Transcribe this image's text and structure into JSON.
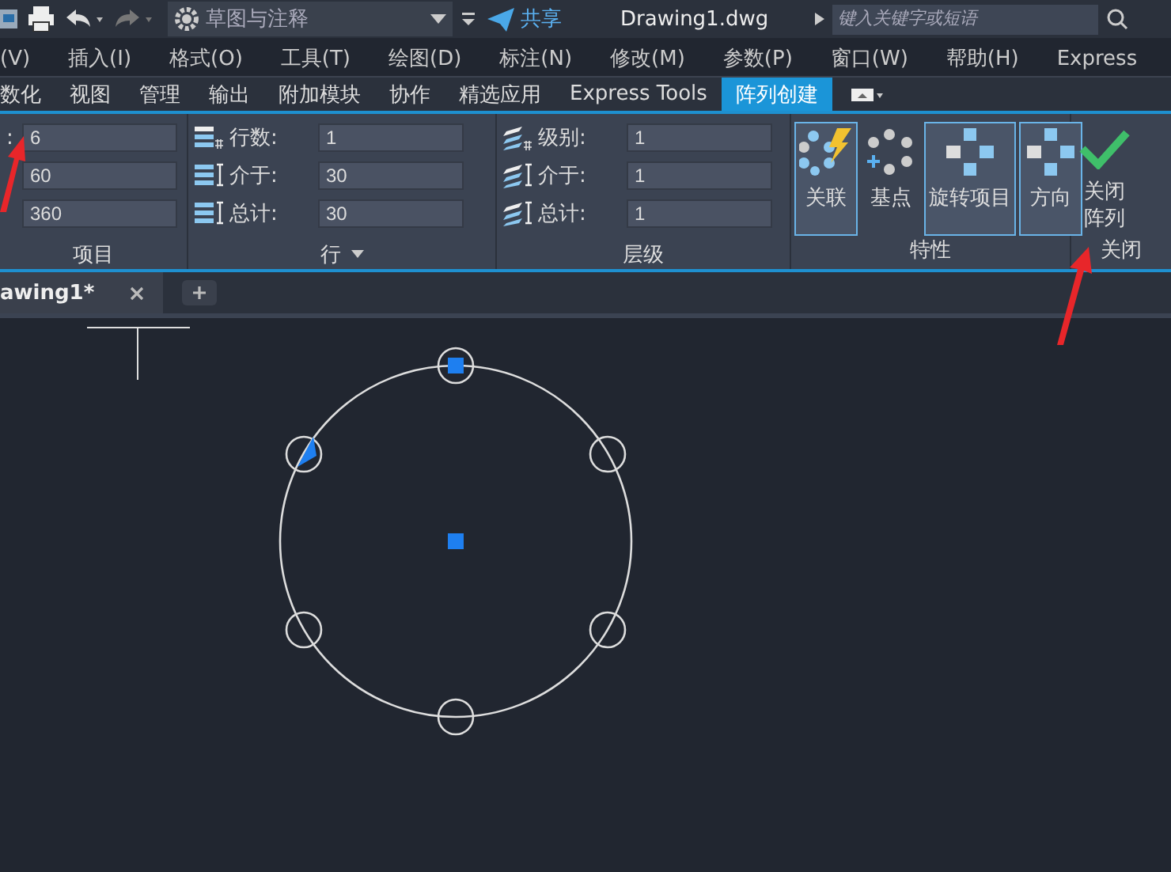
{
  "title_bar": {
    "workspace": "草图与注释",
    "share": "共享",
    "document_title": "Drawing1.dwg",
    "search": {
      "placeholder": "键入关键字或短语"
    }
  },
  "menu_bar": [
    "(V)",
    "插入(I)",
    "格式(O)",
    "工具(T)",
    "绘图(D)",
    "标注(N)",
    "修改(M)",
    "参数(P)",
    "窗口(W)",
    "帮助(H)",
    "Express"
  ],
  "ribbon_tabs": [
    {
      "label": "数化",
      "selected": false
    },
    {
      "label": "视图",
      "selected": false
    },
    {
      "label": "管理",
      "selected": false
    },
    {
      "label": "输出",
      "selected": false
    },
    {
      "label": "附加模块",
      "selected": false
    },
    {
      "label": "协作",
      "selected": false
    },
    {
      "label": "精选应用",
      "selected": false
    },
    {
      "label": "Express Tools",
      "selected": false
    },
    {
      "label": "阵列创建",
      "selected": true
    }
  ],
  "ribbon_panels": [
    {
      "kind": "items",
      "title": "项目",
      "fields": [
        {
          "label": ":",
          "value": "6"
        },
        {
          "value": "60"
        },
        {
          "value": "360"
        }
      ]
    },
    {
      "kind": "rows",
      "title": "行",
      "fields": [
        {
          "label": "行数:",
          "value": "1"
        },
        {
          "label": "介于:",
          "value": "30"
        },
        {
          "label": "总计:",
          "value": "30"
        }
      ]
    },
    {
      "kind": "levels",
      "title": "层级",
      "fields": [
        {
          "label": "级别:",
          "value": "1"
        },
        {
          "label": "介于:",
          "value": "1"
        },
        {
          "label": "总计:",
          "value": "1"
        }
      ]
    },
    {
      "kind": "properties",
      "title": "特性",
      "buttons": [
        {
          "label": "关联",
          "selected": true
        },
        {
          "label": "基点",
          "selected": false
        },
        {
          "label": "旋转项目",
          "selected": true
        },
        {
          "label": "方向",
          "selected": true
        }
      ]
    },
    {
      "kind": "close",
      "title": "关闭",
      "buttons": [
        {
          "lines": [
            "关闭",
            "阵列"
          ],
          "selected": false
        }
      ]
    }
  ],
  "document_tabs": [
    {
      "label": "awing1*",
      "selected": true
    }
  ]
}
